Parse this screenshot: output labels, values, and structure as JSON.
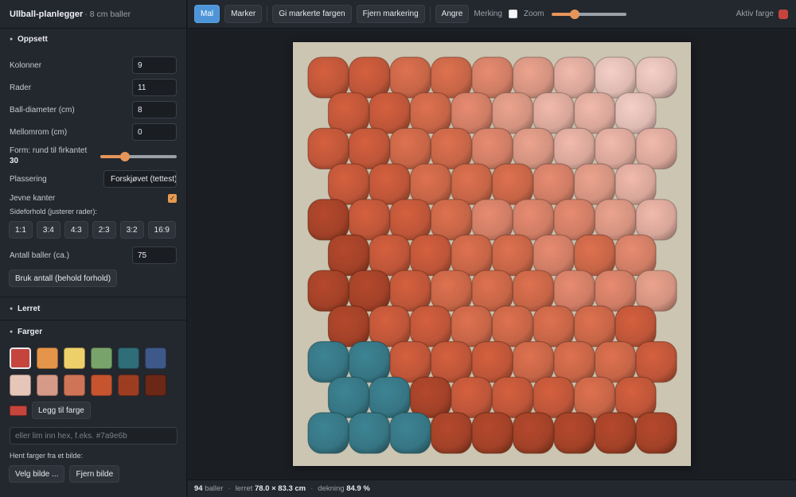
{
  "app": {
    "title": "Ullball-planlegger",
    "subtitle": "· 8 cm baller"
  },
  "setup": {
    "heading": "Oppsett",
    "columns": {
      "label": "Kolonner",
      "value": "9"
    },
    "rows": {
      "label": "Rader",
      "value": "11"
    },
    "diameter": {
      "label": "Ball-diameter (cm)",
      "value": "8"
    },
    "gap": {
      "label": "Mellomrom (cm)",
      "value": "0"
    },
    "shape": {
      "label": "Form: rund til firkantet",
      "value": "30"
    },
    "placement": {
      "label": "Plassering",
      "value": "Forskjøvet (tettest)"
    },
    "even_edges": {
      "label": "Jevne kanter",
      "checked": true
    },
    "aspect_label": "Sideforhold (justerer rader):",
    "aspects": [
      "1:1",
      "3:4",
      "4:3",
      "2:3",
      "3:2",
      "16:9"
    ],
    "ball_count": {
      "label": "Antall baller (ca.)",
      "value": "75"
    },
    "apply_count_label": "Bruk antall (behold forhold)"
  },
  "canvas_section": {
    "heading": "Lerret"
  },
  "colors": {
    "heading": "Farger",
    "palette": [
      "#c5453c",
      "#e5954a",
      "#eed06b",
      "#78a46b",
      "#2f6d78",
      "#3e5889",
      "#e6c6b8",
      "#d69a88",
      "#cf7456",
      "#c5542f",
      "#9c3d22",
      "#6b2817"
    ],
    "active_index": 0,
    "current_color": "#c5453c",
    "add_color_label": "Legg til farge",
    "hex_placeholder": "eller lim inn hex, f.eks. #7a9e6b",
    "from_image_label": "Hent farger fra et bilde:",
    "choose_image_label": "Velg bilde ...",
    "remove_image_label": "Fjern bilde"
  },
  "toolbar": {
    "paint": "Mal",
    "select": "Marker",
    "apply_color": "Gi markerte fargen",
    "clear_selection": "Fjern markering",
    "undo": "Angre",
    "marking_label": "Merking",
    "zoom_label": "Zoom",
    "zoom_value": 28,
    "active_color_label": "Aktiv farge",
    "active_color": "#c5453c"
  },
  "status": {
    "balls": "94",
    "balls_label": "baller",
    "canvas_label": "lerret",
    "canvas_size": "78.0 × 83.3 cm",
    "coverage_label": "dekning",
    "coverage": "84.9 %"
  },
  "grid": {
    "colors": {
      "a": "#c65a3c",
      "b": "#cf6a4b",
      "c": "#d8826a",
      "d": "#dc9985",
      "e": "#e1ada0",
      "f": "#e7c2ba",
      "g": "#a9452c",
      "h": "#8f3a24",
      "t": "#3a7b8a"
    },
    "rows": [
      "aabbcdeff",
      "aabcdeef",
      "aabbcdeee",
      "aabbbcde",
      "gaabcccde",
      "gaabbcbc",
      "ggabbbccd",
      "gaabbbba",
      "ttaaabbba",
      "ttgaaaba",
      "tttgggggg"
    ]
  }
}
